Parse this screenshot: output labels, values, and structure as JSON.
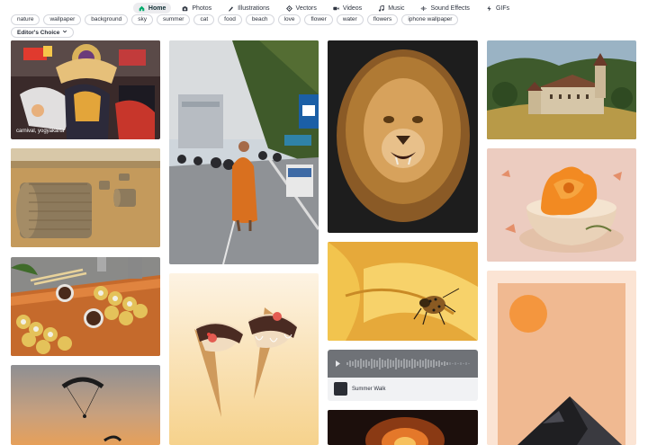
{
  "nav": {
    "tabs": [
      {
        "label": "Home",
        "icon": "home-icon"
      },
      {
        "label": "Photos",
        "icon": "camera-icon"
      },
      {
        "label": "Illustrations",
        "icon": "pen-icon"
      },
      {
        "label": "Vectors",
        "icon": "vector-icon"
      },
      {
        "label": "Videos",
        "icon": "video-icon"
      },
      {
        "label": "Music",
        "icon": "music-icon"
      },
      {
        "label": "Sound Effects",
        "icon": "sound-icon"
      },
      {
        "label": "GIFs",
        "icon": "gif-icon"
      }
    ]
  },
  "tags": [
    "nature",
    "wallpaper",
    "background",
    "sky",
    "summer",
    "cat",
    "food",
    "beach",
    "love",
    "flower",
    "water",
    "flowers",
    "iphone wallpaper"
  ],
  "filter": {
    "label": "Editor's Choice"
  },
  "tiles": {
    "festival_caption": "carnival, yogyakarta"
  },
  "audio": {
    "title": "Summer Walk"
  },
  "colors": {
    "accent": "#00ab6b",
    "chip_border": "#d5d7dd"
  }
}
